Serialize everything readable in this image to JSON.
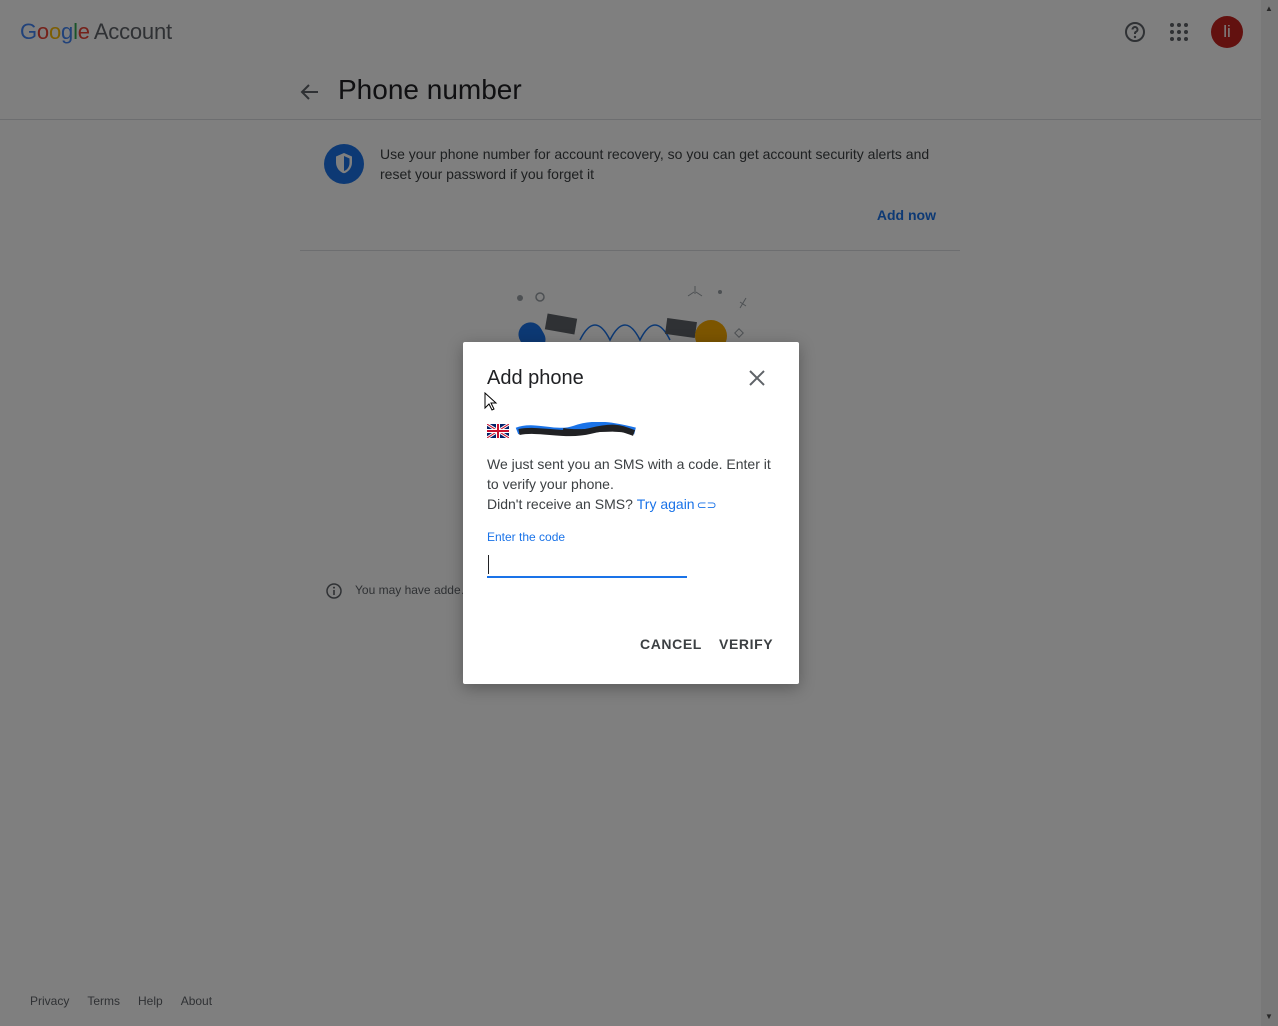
{
  "header": {
    "logo_word": [
      "G",
      "o",
      "o",
      "g",
      "l",
      "e"
    ],
    "logo_suffix": "Account",
    "avatar_letter": "li",
    "help_icon": "help-circle-icon",
    "apps_icon": "apps-grid-icon"
  },
  "titlebar": {
    "title": "Phone number",
    "back_icon": "arrow-back-icon"
  },
  "info_card": {
    "text": "Use your phone number for account recovery, so you can get account security alerts and reset your password if you forget it",
    "action": "Add now",
    "icon": "shield-icon"
  },
  "note": {
    "text": "You may have adde… ed to a Google service isn't listed here, go"
  },
  "footer": {
    "links": [
      "Privacy",
      "Terms",
      "Help",
      "About"
    ]
  },
  "dialog": {
    "title": "Add phone",
    "message_line1": "We just sent you an SMS with a code. Enter it to verify your phone.",
    "message_line2_prefix": "Didn't receive an SMS?",
    "try_again": "Try again",
    "code_label": "Enter the code",
    "code_value": "",
    "cancel_label": "CANCEL",
    "verify_label": "VERIFY",
    "flag": "uk-flag-icon"
  },
  "colors": {
    "accent": "#1a73e8",
    "avatar_bg": "#c5221f",
    "scrim": "rgba(0,0,0,0.5)"
  }
}
